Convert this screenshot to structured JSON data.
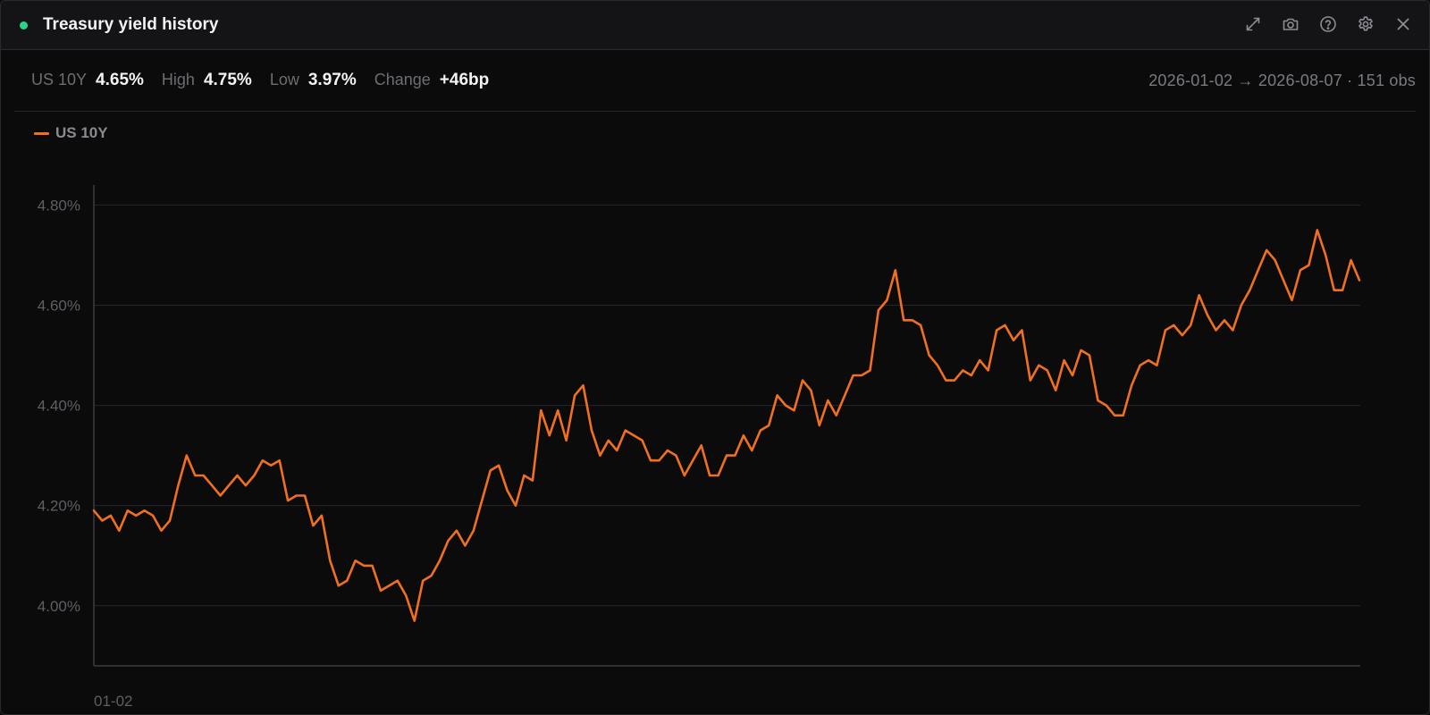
{
  "window": {
    "title": "Treasury yield history",
    "status_color": "#2bd48a",
    "actions": [
      "expand-icon",
      "camera-icon",
      "help-icon",
      "gear-icon",
      "close-icon"
    ]
  },
  "stats": [
    {
      "label": "US 10Y",
      "value": "4.65%"
    },
    {
      "label": "High",
      "value": "4.75%"
    },
    {
      "label": "Low",
      "value": "3.97%"
    },
    {
      "label": "Change",
      "value": "+46bp"
    }
  ],
  "range_text": "2026-01-02 → 2026-08-07 · 151 obs",
  "colors": {
    "series": "#f07020",
    "grid": "#26262a",
    "axis": "#3c3c41"
  },
  "chart_data": {
    "type": "line",
    "title": "",
    "xlabel": "",
    "ylabel": "",
    "ylim": [
      3.88,
      4.84
    ],
    "yticks": [
      4.0,
      4.2,
      4.4,
      4.6,
      4.8
    ],
    "ytick_labels": [
      "4.00%",
      "4.20%",
      "4.40%",
      "4.60%",
      "4.80%"
    ],
    "xtick_labels": [
      "01-02"
    ],
    "grid": true,
    "legend": "top-left",
    "x_start": "2026-01-02",
    "x_end": "2026-08-07",
    "series": [
      {
        "name": "US 10Y",
        "values": [
          4.19,
          4.17,
          4.18,
          4.15,
          4.19,
          4.18,
          4.19,
          4.18,
          4.15,
          4.17,
          4.24,
          4.3,
          4.26,
          4.26,
          4.24,
          4.22,
          4.24,
          4.26,
          4.24,
          4.26,
          4.29,
          4.28,
          4.29,
          4.21,
          4.22,
          4.22,
          4.16,
          4.18,
          4.09,
          4.04,
          4.05,
          4.09,
          4.08,
          4.08,
          4.03,
          4.04,
          4.05,
          4.02,
          3.97,
          4.05,
          4.06,
          4.09,
          4.13,
          4.15,
          4.12,
          4.15,
          4.21,
          4.27,
          4.28,
          4.23,
          4.2,
          4.26,
          4.25,
          4.39,
          4.34,
          4.39,
          4.33,
          4.42,
          4.44,
          4.35,
          4.3,
          4.33,
          4.31,
          4.35,
          4.34,
          4.33,
          4.29,
          4.29,
          4.31,
          4.3,
          4.26,
          4.29,
          4.32,
          4.26,
          4.26,
          4.3,
          4.3,
          4.34,
          4.31,
          4.35,
          4.36,
          4.42,
          4.4,
          4.39,
          4.45,
          4.43,
          4.36,
          4.41,
          4.38,
          4.42,
          4.46,
          4.46,
          4.47,
          4.59,
          4.61,
          4.67,
          4.57,
          4.57,
          4.56,
          4.5,
          4.48,
          4.45,
          4.45,
          4.47,
          4.46,
          4.49,
          4.47,
          4.55,
          4.56,
          4.53,
          4.55,
          4.45,
          4.48,
          4.47,
          4.43,
          4.49,
          4.46,
          4.51,
          4.5,
          4.41,
          4.4,
          4.38,
          4.38,
          4.44,
          4.48,
          4.49,
          4.48,
          4.55,
          4.56,
          4.54,
          4.56,
          4.62,
          4.58,
          4.55,
          4.57,
          4.55,
          4.6,
          4.63,
          4.67,
          4.71,
          4.69,
          4.65,
          4.61,
          4.67,
          4.68,
          4.75,
          4.7,
          4.63,
          4.63,
          4.69,
          4.65
        ]
      }
    ]
  }
}
